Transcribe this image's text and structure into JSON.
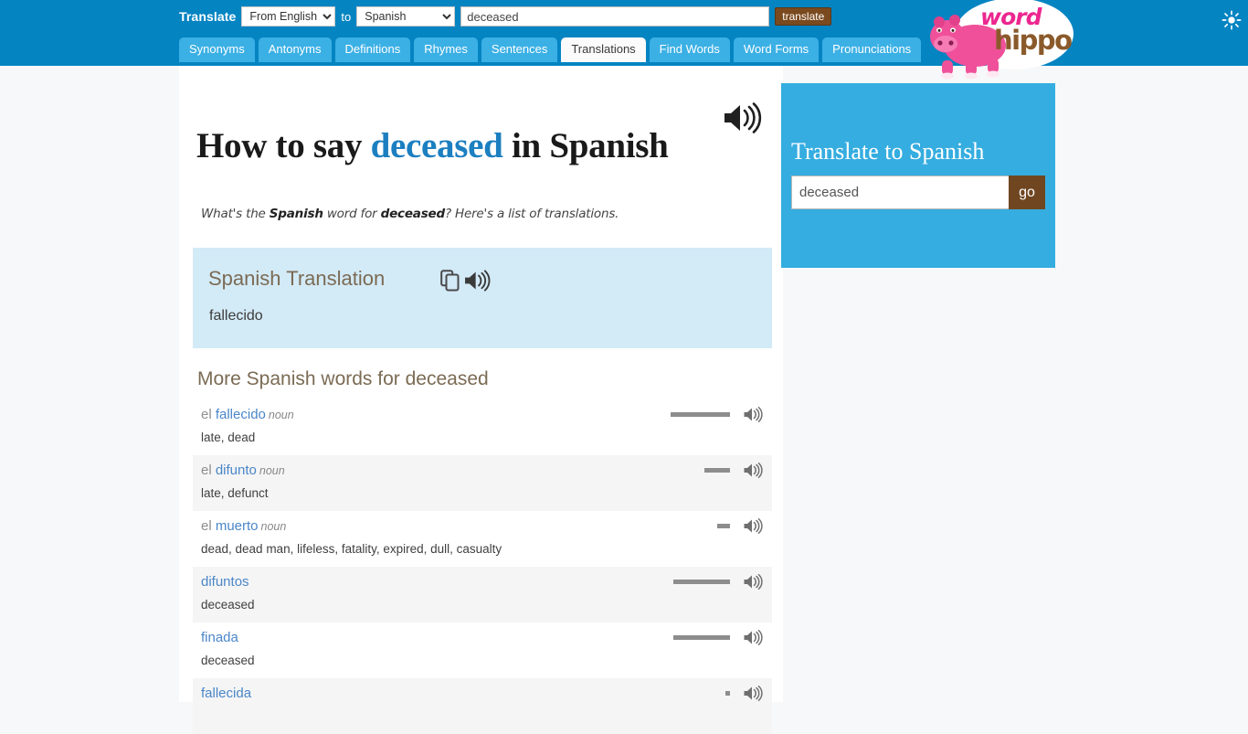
{
  "topbar": {
    "translate_label": "Translate",
    "from_select": {
      "value": "From English",
      "options": [
        "From English"
      ]
    },
    "to_word": "to",
    "to_select": {
      "value": "Spanish",
      "options": [
        "Spanish"
      ]
    },
    "search_value": "deceased",
    "search_placeholder": "",
    "translate_button": "translate",
    "sun_icon": "sun-icon"
  },
  "logo": {
    "word": "word",
    "hippo": "hippo"
  },
  "tabs": [
    {
      "label": "Synonyms",
      "active": false
    },
    {
      "label": "Antonyms",
      "active": false
    },
    {
      "label": "Definitions",
      "active": false
    },
    {
      "label": "Rhymes",
      "active": false
    },
    {
      "label": "Sentences",
      "active": false
    },
    {
      "label": "Translations",
      "active": true
    },
    {
      "label": "Find Words",
      "active": false
    },
    {
      "label": "Word Forms",
      "active": false
    },
    {
      "label": "Pronunciations",
      "active": false
    }
  ],
  "heading": {
    "prefix": "How to say ",
    "word": "deceased",
    "suffix": " in Spanish",
    "speaker_icon": "speaker-icon"
  },
  "subtitle": {
    "part1": "What's the ",
    "bold1": "Spanish",
    "part2": " word for ",
    "bold2": "deceased",
    "part3": "? Here's a list of translations."
  },
  "translation_box": {
    "title": "Spanish Translation",
    "copy_icon": "copy-icon",
    "speaker_icon": "speaker-icon",
    "value": "fallecido"
  },
  "more_words": {
    "title": "More Spanish words for deceased",
    "rows": [
      {
        "article": "el ",
        "word": "fallecido",
        "pos": "noun",
        "meanings": "late, dead",
        "bar": 65
      },
      {
        "article": "el ",
        "word": "difunto",
        "pos": "noun",
        "meanings": "late, defunct",
        "bar": 28
      },
      {
        "article": "el ",
        "word": "muerto",
        "pos": "noun",
        "meanings": "dead, dead man, lifeless, fatality, expired, dull, casualty",
        "bar": 14
      },
      {
        "article": "",
        "word": "difuntos",
        "pos": "",
        "meanings": "deceased",
        "bar": 62
      },
      {
        "article": "",
        "word": "finada",
        "pos": "",
        "meanings": "deceased",
        "bar": 62
      },
      {
        "article": "",
        "word": "fallecida",
        "pos": "",
        "meanings": "",
        "bar": 5
      }
    ]
  },
  "sidebar": {
    "title": "Translate to Spanish",
    "input_value": "deceased",
    "input_placeholder": "",
    "go_label": "go"
  },
  "colors": {
    "topbar_blue": "#0584c2",
    "tab_blue": "#3bb0e5",
    "sidebar_blue": "#35ade0",
    "brown": "#6f4620",
    "link_blue": "#4a86c8",
    "heading_accent": "#1b7fc0",
    "trans_box_blue": "#d3eaf7",
    "section_title_brown": "#7b6b54"
  }
}
